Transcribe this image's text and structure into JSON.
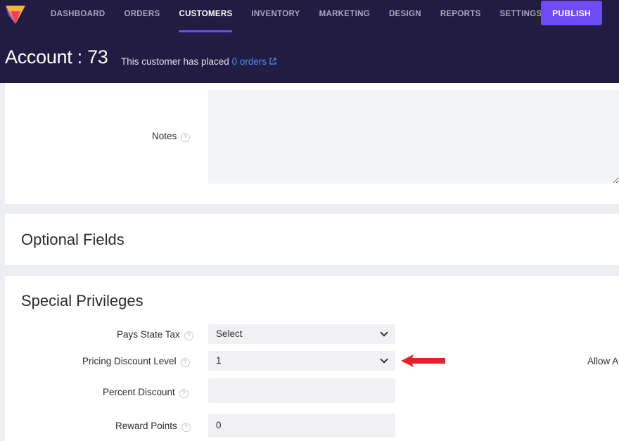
{
  "nav": {
    "items": [
      {
        "label": "DASHBOARD"
      },
      {
        "label": "ORDERS"
      },
      {
        "label": "CUSTOMERS",
        "active": true
      },
      {
        "label": "INVENTORY"
      },
      {
        "label": "MARKETING"
      },
      {
        "label": "DESIGN"
      },
      {
        "label": "REPORTS"
      },
      {
        "label": "SETTINGS"
      }
    ],
    "publish_label": "PUBLISH"
  },
  "header": {
    "title": "Account : 73",
    "subtitle_prefix": "This customer has placed",
    "orders_link": "0 orders"
  },
  "notes": {
    "label": "Notes",
    "help": "?",
    "value": ""
  },
  "optional_fields": {
    "title": "Optional Fields"
  },
  "special_privileges": {
    "title": "Special Privileges",
    "pays_state_tax": {
      "label": "Pays State Tax",
      "help": "?",
      "value": "Select"
    },
    "pricing_discount_level": {
      "label": "Pricing Discount Level",
      "help": "?",
      "value": "1"
    },
    "percent_discount": {
      "label": "Percent Discount",
      "help": "?",
      "value": ""
    },
    "reward_points": {
      "label": "Reward Points",
      "help": "?",
      "value": "0"
    },
    "allow_label": "Allow A"
  },
  "colors": {
    "topbar": "#221c42",
    "accent": "#6d4cf5",
    "link": "#4f8ff7",
    "annotation_arrow": "#e3232a"
  },
  "icons": {
    "logo": "brand-logo-icon",
    "external_link": "external-link-icon",
    "help": "help-circle-icon",
    "dropdown": "chevron-down-icon",
    "annotation": "red-arrow-icon"
  }
}
